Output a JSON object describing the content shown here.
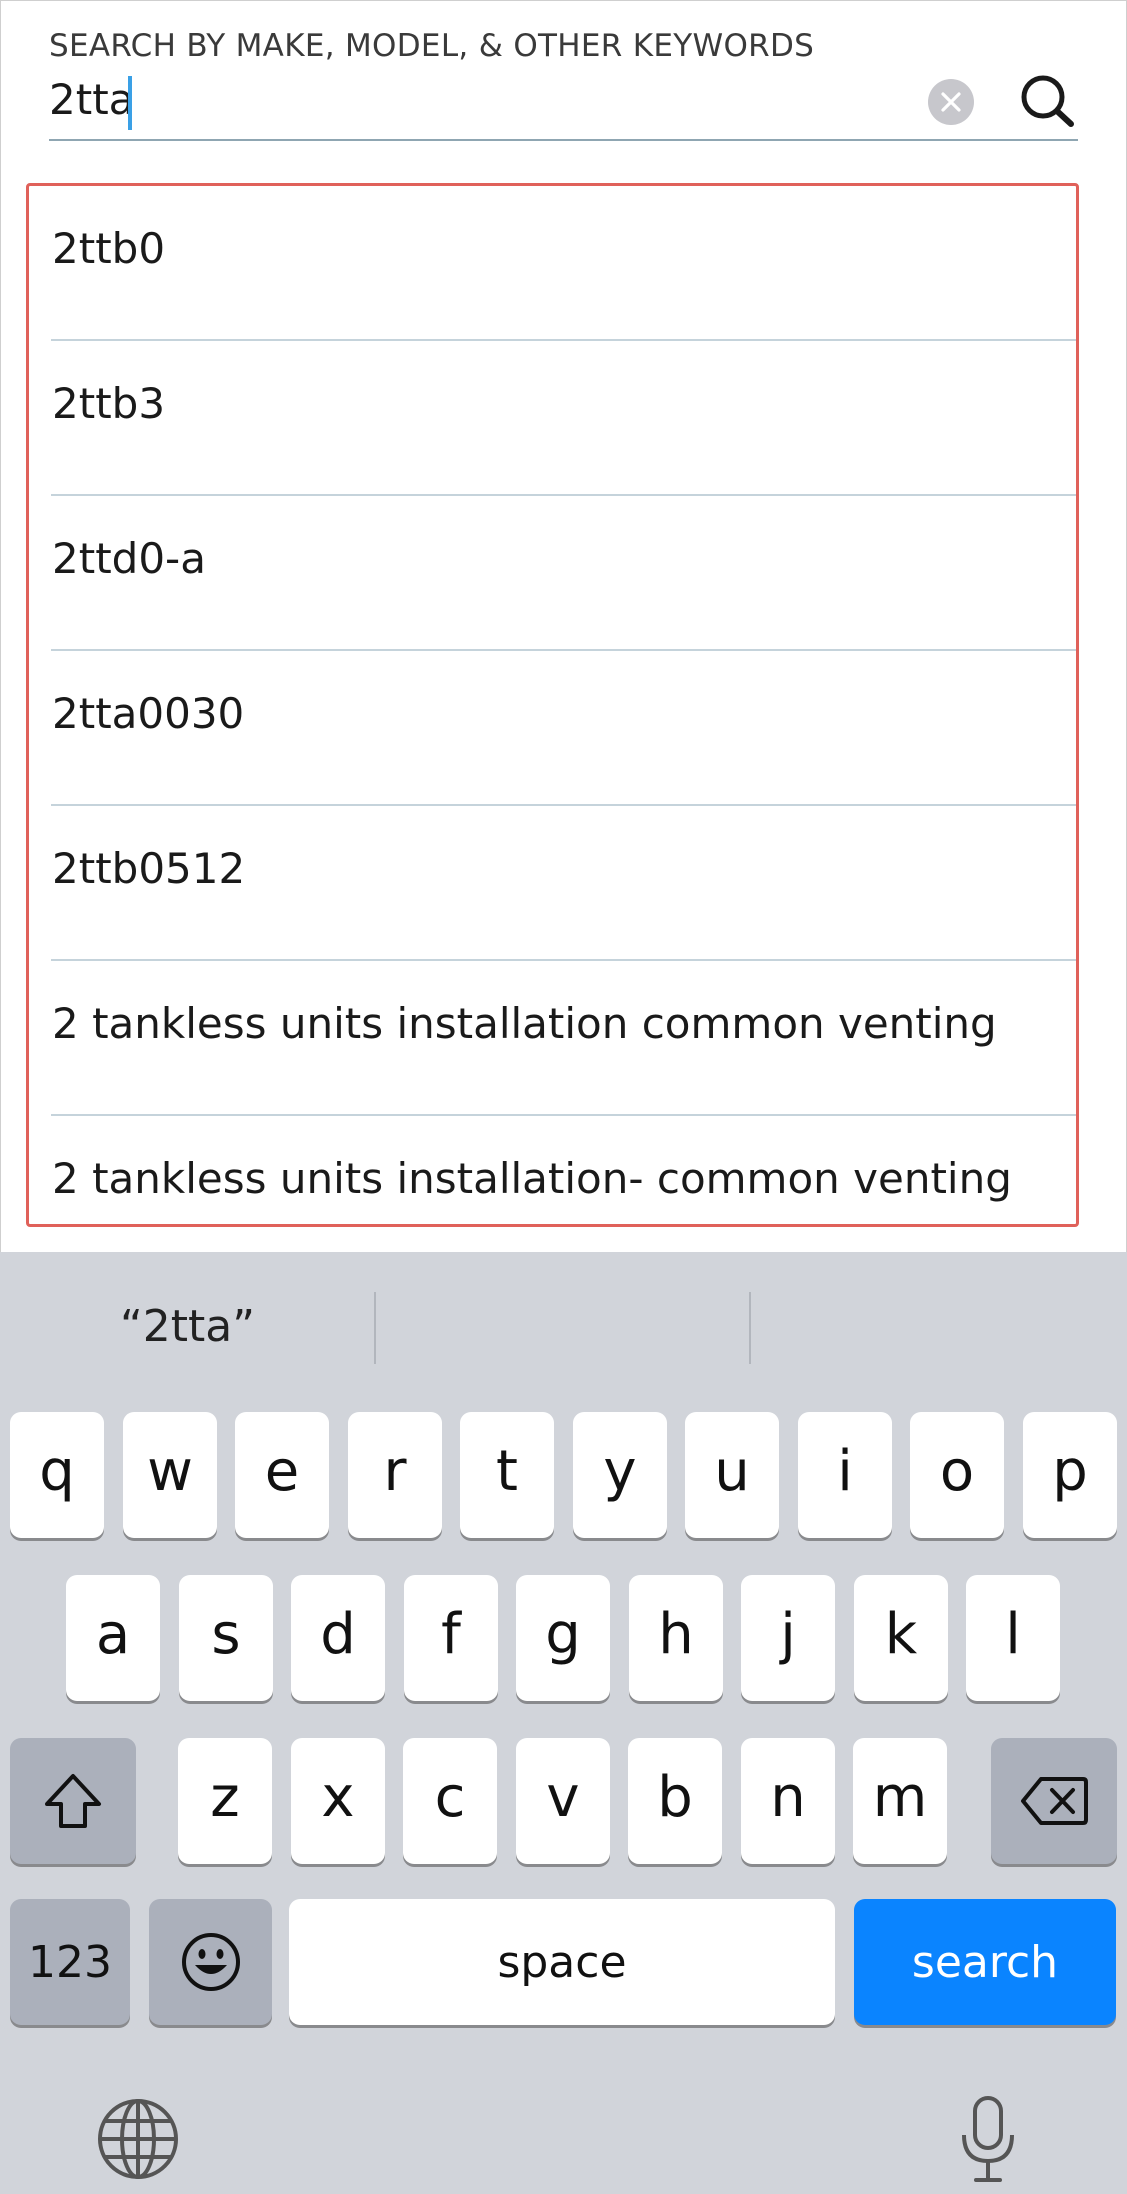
{
  "search": {
    "label": "SEARCH BY MAKE, MODEL, & OTHER KEYWORDS",
    "value": "2tta",
    "clear_icon": "clear-icon",
    "search_icon": "search-icon"
  },
  "suggestions": [
    "2ttb0",
    "2ttb3",
    "2ttd0-a",
    "2tta0030",
    "2ttb0512",
    "2 tankless units installation common venting",
    "2 tankless units installation- common venting"
  ],
  "keyboard": {
    "prediction_1": "“2tta”",
    "row1": [
      "q",
      "w",
      "e",
      "r",
      "t",
      "y",
      "u",
      "i",
      "o",
      "p"
    ],
    "row2": [
      "a",
      "s",
      "d",
      "f",
      "g",
      "h",
      "j",
      "k",
      "l"
    ],
    "row3": [
      "z",
      "x",
      "c",
      "v",
      "b",
      "n",
      "m"
    ],
    "numbers_label": "123",
    "space_label": "space",
    "search_label": "search",
    "icons": [
      "shift-icon",
      "backspace-icon",
      "emoji-icon",
      "globe-icon",
      "microphone-icon"
    ]
  },
  "colors": {
    "highlight_border": "#e0615a",
    "caret": "#3aa0e6",
    "search_key": "#0a84ff",
    "keyboard_bg": "#d1d4da"
  }
}
